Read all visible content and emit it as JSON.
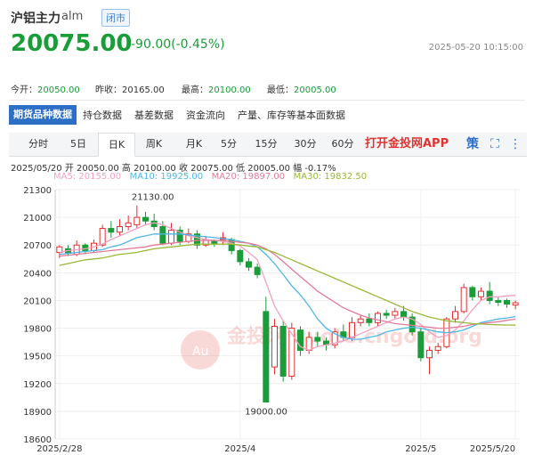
{
  "header": {
    "title": "沪铝主力",
    "code": "alm",
    "status": "闭市",
    "price": "20075.00",
    "change": "-90.00(-0.45%)",
    "timestamp": "2025-05-20 10:15:00"
  },
  "stats": {
    "open_label": "今开：",
    "open": "20050.00",
    "prev_label": "昨收：",
    "prev": "20165.00",
    "high_label": "最高：",
    "high": "20100.00",
    "low_label": "最低：",
    "low": "20005.00"
  },
  "nav": {
    "items": [
      "期货品种数据",
      "持仓数据",
      "基差数据",
      "资金流向",
      "产量、库存等基本面数据"
    ]
  },
  "periods": [
    "分时",
    "5日",
    "日K",
    "周K",
    "月K",
    "5分",
    "15分",
    "30分",
    "60分"
  ],
  "app_link": "打开金投网APP",
  "tools": {
    "settings_glyph": "策",
    "fullscreen_glyph": "⛶",
    "more_glyph": "⋮"
  },
  "ohlc_line": "2025/05/20  开 20050.00  高 20100.00  收 20075.00  低 20005.00  幅 -0.17%",
  "ma_line": {
    "ma5": "MA5: 20155.00",
    "ma10": "MA10: 19925.00",
    "ma20": "MA20: 19897.00",
    "ma30": "MA30: 19832.50"
  },
  "colors": {
    "up": "#e0322e",
    "down": "#1a9d38",
    "ma5": "#f2a1c0",
    "ma10": "#4fb6e6",
    "ma20": "#e37b9a",
    "ma30": "#9ab93a",
    "nav_active": "#2d6fc6"
  },
  "watermark": "金投网 quote.cngold.org",
  "chart_data": {
    "type": "candlestick",
    "ylim": [
      18600,
      21300
    ],
    "yticks": [
      21300,
      21000,
      20700,
      20400,
      20100,
      19800,
      19500,
      19200,
      18900,
      18600
    ],
    "xtick_labels": [
      {
        "label": "2025/2/28",
        "index": 0
      },
      {
        "label": "2025/4",
        "index": 21
      },
      {
        "label": "2025/5",
        "index": 42
      },
      {
        "label": "2025/5/20",
        "index": 53
      }
    ],
    "annotations": [
      {
        "text": "21130.00",
        "index": 9,
        "value": 21130
      },
      {
        "text": "19000.00",
        "index": 23,
        "value": 19000
      }
    ],
    "candles": [
      [
        20620,
        20680,
        20560,
        20700
      ],
      [
        20660,
        20610,
        20580,
        20700
      ],
      [
        20600,
        20700,
        20580,
        20750
      ],
      [
        20700,
        20640,
        20600,
        20720
      ],
      [
        20640,
        20720,
        20620,
        20760
      ],
      [
        20700,
        20880,
        20680,
        20920
      ],
      [
        20880,
        20840,
        20780,
        20960
      ],
      [
        20840,
        20900,
        20800,
        20980
      ],
      [
        20900,
        20940,
        20860,
        21020
      ],
      [
        20920,
        21000,
        20880,
        21130
      ],
      [
        21000,
        20960,
        20920,
        21060
      ],
      [
        20960,
        20900,
        20860,
        21040
      ],
      [
        20900,
        20720,
        20700,
        20960
      ],
      [
        20720,
        20860,
        20700,
        20940
      ],
      [
        20860,
        20740,
        20700,
        20900
      ],
      [
        20740,
        20820,
        20720,
        20880
      ],
      [
        20820,
        20700,
        20660,
        20860
      ],
      [
        20700,
        20760,
        20680,
        20800
      ],
      [
        20740,
        20720,
        20680,
        20760
      ],
      [
        20760,
        20780,
        20700,
        20840
      ],
      [
        20760,
        20640,
        20600,
        20780
      ],
      [
        20640,
        20520,
        20480,
        20660
      ],
      [
        20520,
        20460,
        20420,
        20560
      ],
      [
        20460,
        20380,
        20340,
        20500
      ],
      [
        19980,
        19000,
        19000,
        20140
      ],
      [
        19380,
        19820,
        19300,
        19900
      ],
      [
        19820,
        19280,
        19220,
        19880
      ],
      [
        19280,
        19800,
        19240,
        19860
      ],
      [
        19780,
        19560,
        19500,
        19820
      ],
      [
        19560,
        19700,
        19520,
        19760
      ],
      [
        19700,
        19660,
        19600,
        19760
      ],
      [
        19660,
        19620,
        19560,
        19700
      ],
      [
        19620,
        19760,
        19580,
        19800
      ],
      [
        19760,
        19700,
        19660,
        19840
      ],
      [
        19700,
        19860,
        19660,
        19920
      ],
      [
        19860,
        19900,
        19820,
        19940
      ],
      [
        19900,
        19860,
        19820,
        19960
      ],
      [
        19860,
        19960,
        19820,
        19980
      ],
      [
        19960,
        19940,
        19900,
        20000
      ],
      [
        19940,
        19980,
        19900,
        20020
      ],
      [
        19980,
        19920,
        19880,
        20040
      ],
      [
        19920,
        19760,
        19720,
        19960
      ],
      [
        19760,
        19480,
        19440,
        19800
      ],
      [
        19480,
        19560,
        19300,
        19600
      ],
      [
        19560,
        19600,
        19520,
        19640
      ],
      [
        19600,
        19900,
        19580,
        19920
      ],
      [
        19900,
        19980,
        19860,
        20040
      ],
      [
        19980,
        20240,
        19960,
        20280
      ],
      [
        20240,
        20140,
        20100,
        20260
      ],
      [
        20140,
        20200,
        20100,
        20240
      ],
      [
        20200,
        20100,
        20060,
        20300
      ],
      [
        20100,
        20080,
        20040,
        20140
      ],
      [
        20100,
        20060,
        20020,
        20120
      ],
      [
        20050,
        20075,
        20005,
        20100
      ]
    ],
    "ma_series": [
      {
        "name": "MA5",
        "values": [
          20620,
          20640,
          20650,
          20660,
          20680,
          20710,
          20760,
          20800,
          20840,
          20880,
          20920,
          20940,
          20920,
          20880,
          20840,
          20800,
          20780,
          20760,
          20750,
          20740,
          20720,
          20690,
          20620,
          20540,
          20300,
          20040,
          19880,
          19740,
          19600,
          19560,
          19600,
          19620,
          19640,
          19660,
          19700,
          19740,
          19780,
          19820,
          19860,
          19900,
          19920,
          19900,
          19840,
          19760,
          19700,
          19720,
          19780,
          19880,
          20000,
          20100,
          20140,
          20140,
          20150,
          20155
        ]
      },
      {
        "name": "MA10",
        "values": [
          20600,
          20610,
          20620,
          20630,
          20640,
          20650,
          20680,
          20700,
          20740,
          20780,
          20800,
          20820,
          20820,
          20820,
          20820,
          20810,
          20800,
          20790,
          20780,
          20770,
          20760,
          20740,
          20720,
          20680,
          20600,
          20500,
          20380,
          20260,
          20160,
          20040,
          19900,
          19800,
          19740,
          19700,
          19680,
          19680,
          19700,
          19720,
          19760,
          19780,
          19800,
          19810,
          19800,
          19780,
          19760,
          19750,
          19760,
          19780,
          19820,
          19860,
          19880,
          19900,
          19910,
          19925
        ]
      },
      {
        "name": "MA20",
        "values": [
          20580,
          20590,
          20600,
          20610,
          20620,
          20630,
          20640,
          20650,
          20660,
          20670,
          20680,
          20700,
          20710,
          20720,
          20730,
          20740,
          20750,
          20750,
          20750,
          20750,
          20740,
          20730,
          20720,
          20700,
          20660,
          20600,
          20520,
          20440,
          20360,
          20280,
          20200,
          20140,
          20080,
          20020,
          19980,
          19940,
          19910,
          19890,
          19870,
          19850,
          19840,
          19830,
          19820,
          19810,
          19800,
          19800,
          19810,
          19820,
          19840,
          19850,
          19860,
          19870,
          19885,
          19897
        ]
      },
      {
        "name": "MA30",
        "values": [
          20480,
          20500,
          20520,
          20540,
          20550,
          20560,
          20580,
          20600,
          20610,
          20620,
          20640,
          20660,
          20670,
          20680,
          20690,
          20700,
          20710,
          20710,
          20710,
          20710,
          20710,
          20700,
          20690,
          20680,
          20650,
          20620,
          20580,
          20540,
          20500,
          20460,
          20420,
          20380,
          20340,
          20300,
          20260,
          20220,
          20180,
          20140,
          20100,
          20060,
          20020,
          19980,
          19950,
          19920,
          19900,
          19880,
          19870,
          19860,
          19850,
          19845,
          19840,
          19836,
          19834,
          19832.5
        ]
      }
    ]
  }
}
